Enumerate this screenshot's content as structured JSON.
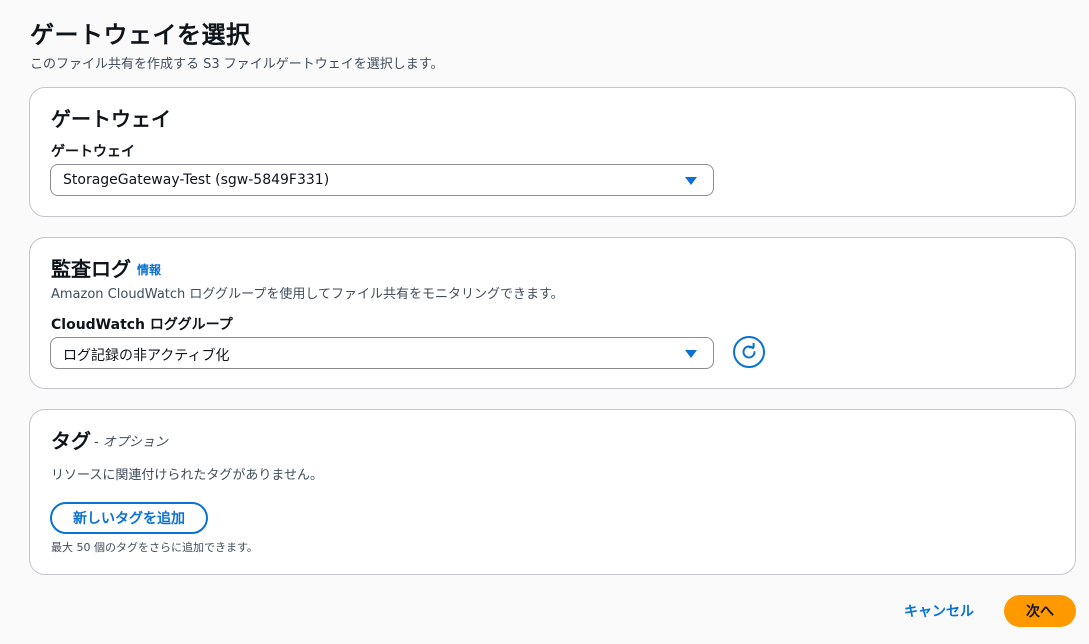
{
  "page": {
    "title": "ゲートウェイを選択",
    "description": "このファイル共有を作成する S3 ファイルゲートウェイを選択します。"
  },
  "gateway_section": {
    "title": "ゲートウェイ",
    "field_label": "ゲートウェイ",
    "selected_value": "StorageGateway-Test (sgw-5849F331)"
  },
  "audit_section": {
    "title": "監査ログ",
    "info_link": "情報",
    "description": "Amazon CloudWatch ロググループを使用してファイル共有をモニタリングできます。",
    "field_label": "CloudWatch ロググループ",
    "selected_value": "ログ記録の非アクティブ化",
    "refresh_icon": "refresh-icon"
  },
  "tags_section": {
    "title": "タグ",
    "optional_label": "- オプション",
    "empty_message": "リソースに関連付けられたタグがありません。",
    "add_button": "新しいタグを追加",
    "hint": "最大 50 個のタグをさらに追加できます。"
  },
  "footer": {
    "cancel_label": "キャンセル",
    "next_label": "次へ"
  },
  "colors": {
    "accent": "#0972d3",
    "primary_button": "#ff9900",
    "border": "#c6c6cd"
  }
}
